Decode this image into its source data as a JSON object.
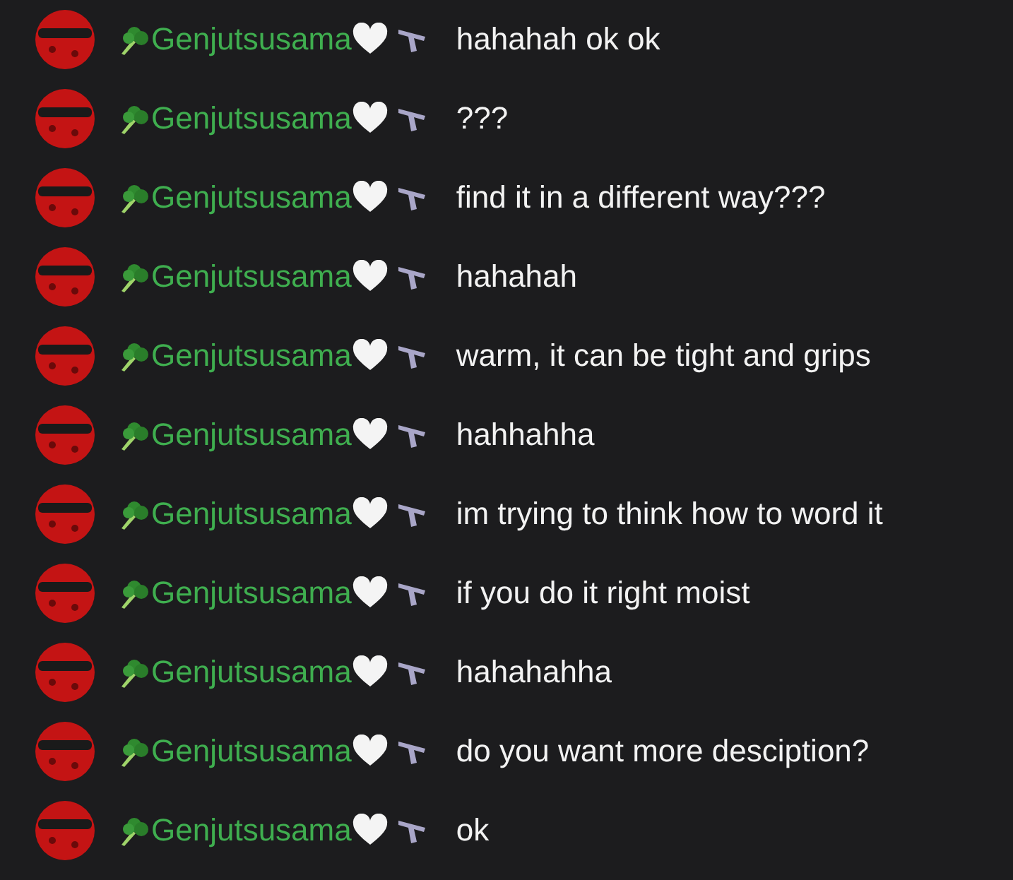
{
  "messages": [
    {
      "author": "Genjutsusama",
      "text": "hahahah ok ok"
    },
    {
      "author": "Genjutsusama",
      "text": "???"
    },
    {
      "author": "Genjutsusama",
      "text": "find it in a different way???"
    },
    {
      "author": "Genjutsusama",
      "text": "hahahah"
    },
    {
      "author": "Genjutsusama",
      "text": "warm, it can be tight and grips"
    },
    {
      "author": "Genjutsusama",
      "text": "hahhahha"
    },
    {
      "author": "Genjutsusama",
      "text": "im trying to think how to word it"
    },
    {
      "author": "Genjutsusama",
      "text": "if you do it right moist"
    },
    {
      "author": "Genjutsusama",
      "text": "hahahahha"
    },
    {
      "author": "Genjutsusama",
      "text": "do you want more desciption?"
    },
    {
      "author": "Genjutsusama",
      "text": "ok"
    }
  ]
}
